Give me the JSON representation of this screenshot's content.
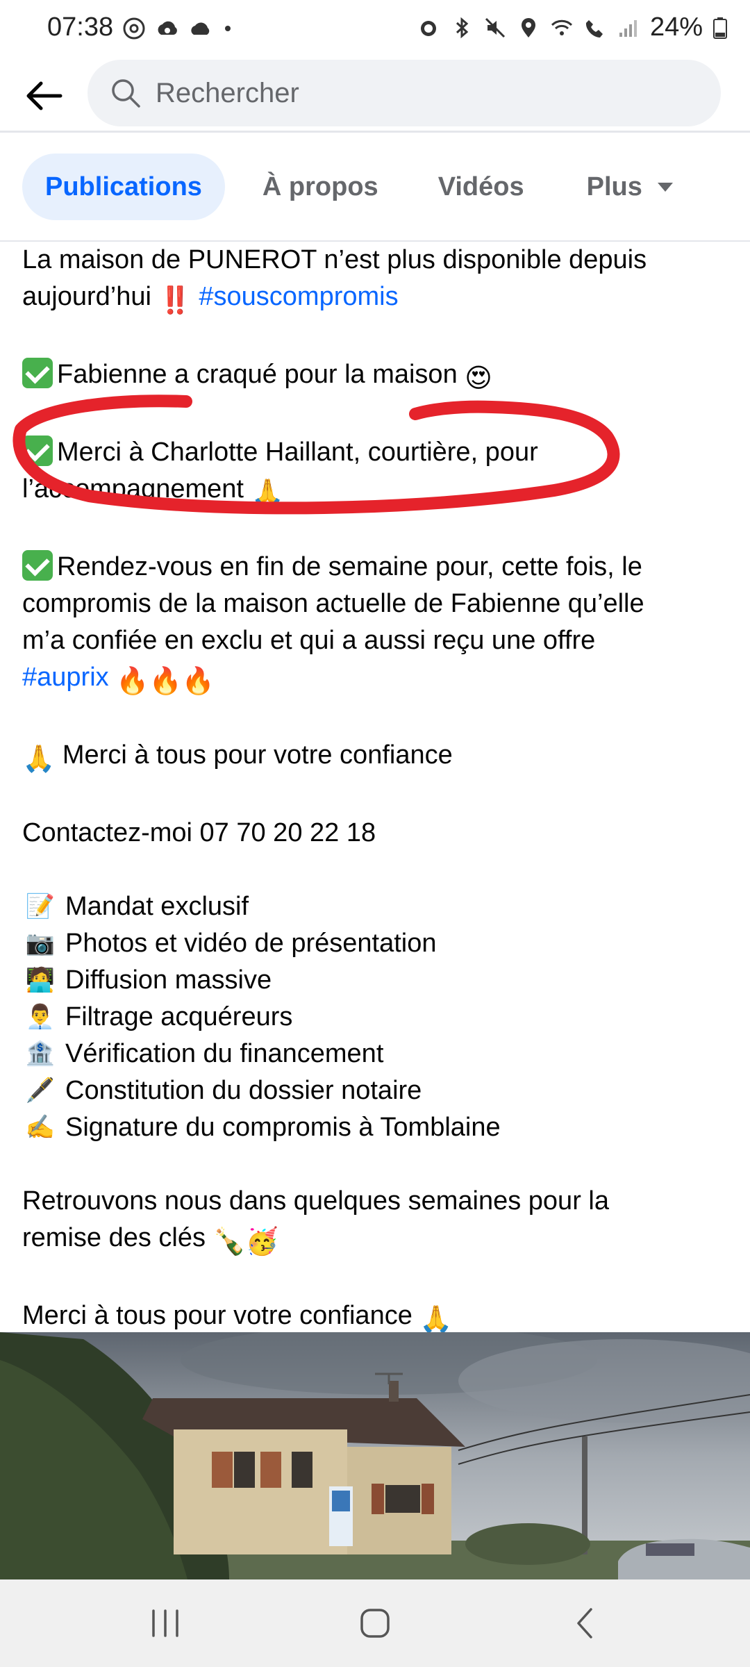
{
  "status_bar": {
    "time": "07:38",
    "battery_text": "24%",
    "icons": [
      "threads-icon",
      "cloud-sync-icon",
      "cloud-icon",
      "dot-icon",
      "alarm-icon",
      "bluetooth-icon",
      "mute-icon",
      "location-icon",
      "wifi-icon",
      "wifi-call-icon",
      "signal-icon",
      "battery-icon"
    ]
  },
  "topbar": {
    "back_icon": "arrow-left-icon",
    "search_placeholder": "Rechercher"
  },
  "tabs": [
    {
      "label": "Publications",
      "active": true
    },
    {
      "label": "À propos",
      "active": false
    },
    {
      "label": "Vidéos",
      "active": false
    },
    {
      "label": "Plus",
      "active": false
    }
  ],
  "post": {
    "line1": "La maison de PUNEROT n’est plus disponible depuis",
    "line2_text": "aujourd’hui",
    "line2_emoji": "‼️",
    "hashtag1": "#souscompromis",
    "item1": "Fabienne a craqué pour la maison",
    "item1_emoji": "😍",
    "item2_line1": "Merci à Charlotte Haillant, courtière, pour",
    "item2_line2": "l’accompagnement",
    "item2_emoji": "🙏",
    "item3_line1": "Rendez-vous en fin de semaine pour, cette fois, le",
    "item3_line2": "compromis de la maison actuelle de Fabienne qu’elle",
    "item3_line3": "m’a confiée en exclu et qui a aussi reçu une offre",
    "hashtag2": "#auprix",
    "fire_emojis": "🔥🔥🔥",
    "thanks1_emoji": "🙏",
    "thanks1": "Merci à tous pour votre confiance",
    "contact": "Contactez-moi 07 70 20 22 18",
    "list": [
      {
        "icon": "memo-icon",
        "emoji": "📝",
        "text": "Mandat exclusif"
      },
      {
        "icon": "camera-icon",
        "emoji": "📷",
        "text": "Photos et vidéo de présentation"
      },
      {
        "icon": "technologist-icon",
        "emoji": "🧑‍💻",
        "text": "Diffusion massive"
      },
      {
        "icon": "man-icon",
        "emoji": "👨‍💼",
        "text": "Filtrage acquéreurs"
      },
      {
        "icon": "bank-icon",
        "emoji": "🏦",
        "text": "Vérification du financement"
      },
      {
        "icon": "pen-icon",
        "emoji": "🖋️",
        "text": "Constitution du dossier notaire"
      },
      {
        "icon": "writing-hand-icon",
        "emoji": "✍️",
        "text": "Signature du compromis à Tomblaine"
      }
    ],
    "closing_line1": "Retrouvons nous dans quelques semaines pour la",
    "closing_line2": "remise des clés",
    "closing_emojis": "🍾🥳",
    "thanks2": "Merci à tous pour votre confiance",
    "thanks2_emoji": "🙏"
  },
  "colors": {
    "accent": "#0866ff",
    "annotation_red": "#e5232b"
  }
}
